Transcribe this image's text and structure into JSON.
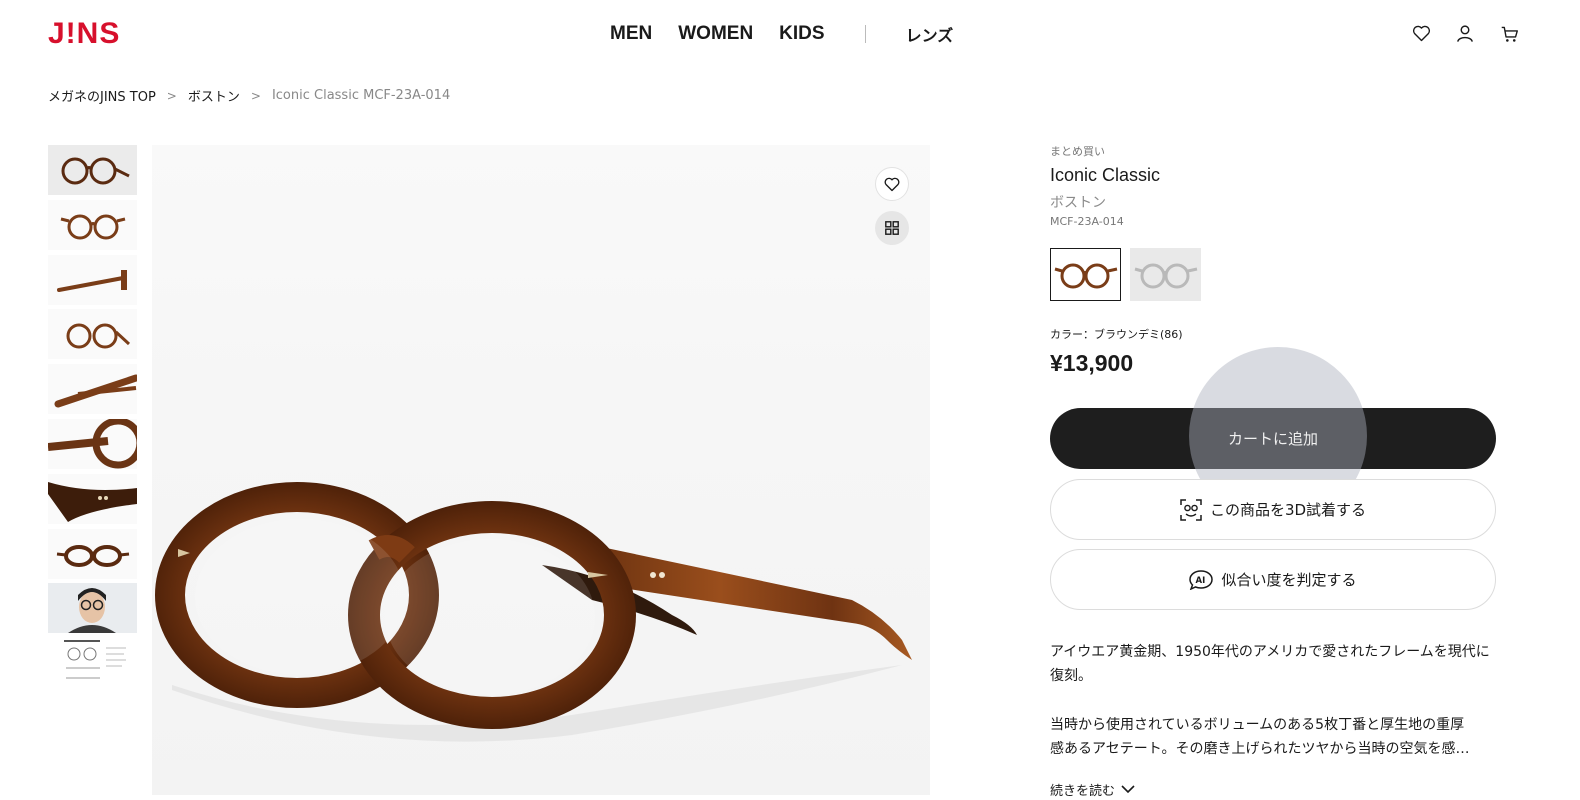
{
  "header": {
    "logo": "J!NS",
    "nav": [
      "MEN",
      "WOMEN",
      "KIDS"
    ],
    "lens": "レンズ",
    "icons": [
      "heart-icon",
      "user-icon",
      "cart-icon"
    ]
  },
  "breadcrumb": {
    "items": [
      "メガネのJINS TOP",
      "ボストン"
    ],
    "current": "Iconic Classic MCF-23A-014",
    "separator": ">"
  },
  "thumbnails": [
    "front-angle",
    "front",
    "side",
    "front-tilted",
    "temple-detail",
    "hinge-detail",
    "temple-rivet",
    "top-view",
    "model-wearing",
    "spec-sheet"
  ],
  "product": {
    "bulk_label": "まとめ買い",
    "name": "Iconic Classic",
    "shape": "ボストン",
    "code": "MCF-23A-014",
    "color_label": "カラー：ブラウンデミ(86)",
    "price": "¥13,900",
    "swatches": [
      {
        "name": "ブラウンデミ",
        "color": "#7a3d18",
        "selected": true
      },
      {
        "name": "clear",
        "color": "#b9b9b9",
        "selected": false
      }
    ]
  },
  "actions": {
    "cart": "カートに追加",
    "try_3d": "この商品を3D試着する",
    "ai_fit": "似合い度を判定する"
  },
  "description": {
    "p1": "アイウエア黄金期、1950年代のアメリカで愛されたフレームを現代に復刻。",
    "p2_line1": "当時から使用されているボリュームのある5枚丁番と厚生地の重厚",
    "p2_line2": "感あるアセテート。その磨き上げられたツヤから当時の空気を感…",
    "read_more": "続きを読む"
  },
  "colors": {
    "brand_red": "#d7102c",
    "button_dark": "#1e1e1e",
    "tortoise": "#7a3d18"
  }
}
